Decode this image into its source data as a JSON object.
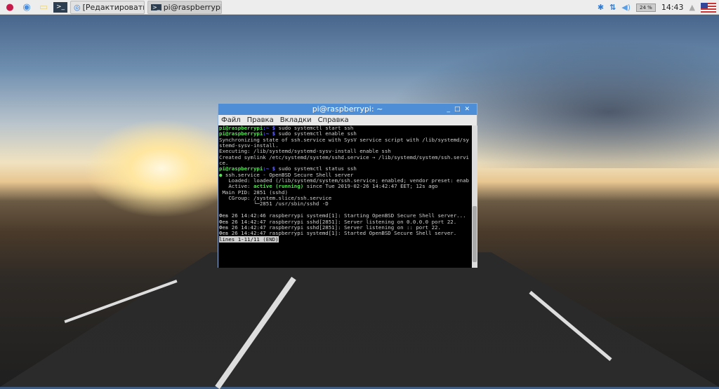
{
  "taskbar": {
    "menu_icon": "raspberry-icon",
    "browser_icon": "globe-icon",
    "files_icon": "folder-icon",
    "terminal_icon": "terminal-icon",
    "tasks": [
      {
        "label": "[Редактировать з...",
        "icon": "chromium-icon"
      },
      {
        "label": "pi@raspberrypi: ~",
        "icon": "terminal-icon"
      }
    ],
    "cpu": "24 %",
    "clock": "14:43"
  },
  "window": {
    "title": "pi@raspberrypi: ~",
    "menu": [
      "Файл",
      "Правка",
      "Вкладки",
      "Справка"
    ]
  },
  "terminal": {
    "prompt_user": "pi@raspberrypi",
    "prompt_sep": ":~ $",
    "cmd1": " sudo systemctl start ssh",
    "cmd2": " sudo systemctl enable ssh",
    "l3": "Synchronizing state of ssh.service with SysV service script with /lib/systemd/sy",
    "l4": "stemd-sysv-install.",
    "l5": "Executing: /lib/systemd/systemd-sysv-install enable ssh",
    "l6": "Created symlink /etc/systemd/system/sshd.service → /lib/systemd/system/ssh.servi",
    "l7": "ce.",
    "cmd3": " sudo systemctl status ssh",
    "dot": "●",
    "l9": " ssh.service - OpenBSD Secure Shell server",
    "l10": "   Loaded: loaded (/lib/systemd/system/ssh.service; enabled; vendor preset: enab",
    "l11a": "   Active: ",
    "l11b": "active (running)",
    "l11c": " since Tue 2019-02-26 14:42:47 EET; 12s ago",
    "l12": " Main PID: 2851 (sshd)",
    "l13": "   CGroup: /system.slice/ssh.service",
    "l14": "           └─2851 /usr/sbin/sshd -D",
    "l16": "Фев 26 14:42:46 raspberrypi systemd[1]: Starting OpenBSD Secure Shell server...",
    "l17": "Фев 26 14:42:47 raspberrypi sshd[2851]: Server listening on 0.0.0.0 port 22.",
    "l18": "Фев 26 14:42:47 raspberrypi sshd[2851]: Server listening on :: port 22.",
    "l19": "Фев 26 14:42:47 raspberrypi systemd[1]: Started OpenBSD Secure Shell server.",
    "pager": "lines 1-11/11 (END)"
  }
}
